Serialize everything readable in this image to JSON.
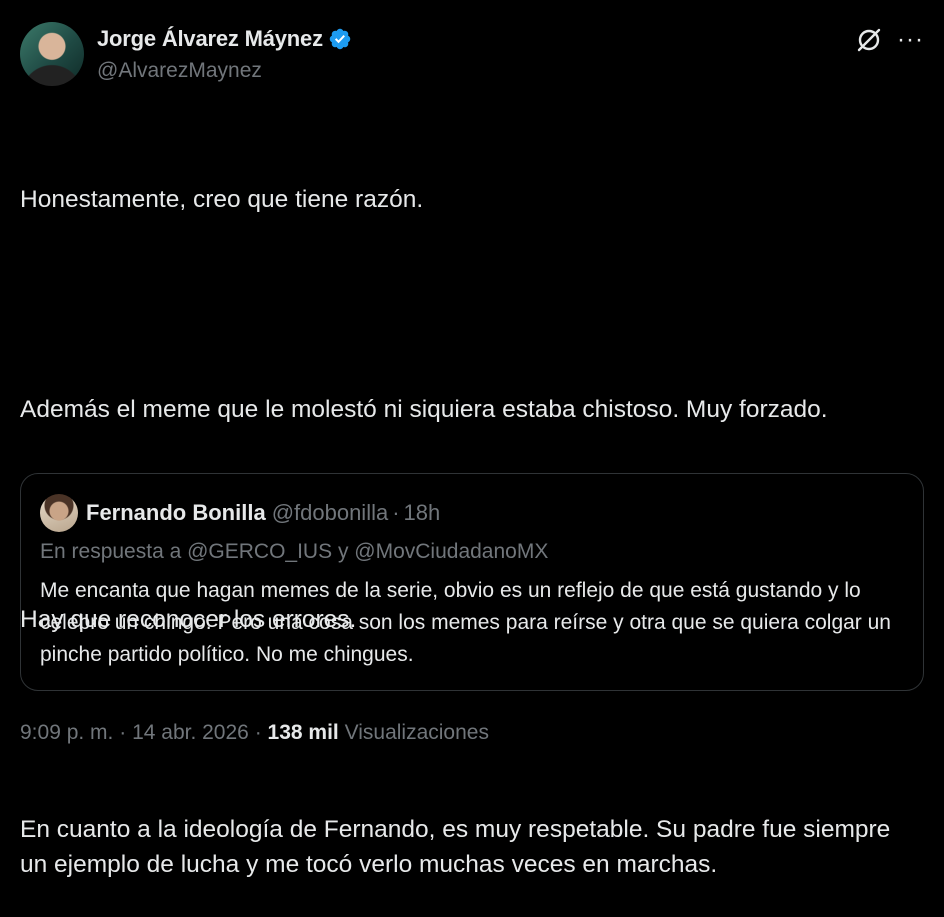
{
  "author": {
    "display_name": "Jorge Álvarez Máynez",
    "handle": "@AlvarezMaynez",
    "verified_icon": "verified-badge-icon"
  },
  "actions": {
    "grok_icon": "grok-icon",
    "more_label": "···"
  },
  "tweet": {
    "paragraphs": [
      "Honestamente, creo que tiene razón.",
      "Además el meme que le molestó ni siquiera estaba chistoso. Muy forzado.",
      "Hay que reconocer los errores.",
      "En cuanto a la ideología de Fernando, es muy respetable. Su padre fue siempre un ejemplo de lucha y me tocó verlo muchas veces en marchas."
    ]
  },
  "quote": {
    "display_name": "Fernando Bonilla",
    "handle": "@fdobonilla",
    "separator": "·",
    "time": "18h",
    "reply_context": "En respuesta a @GERCO_IUS y @MovCiudadanoMX",
    "text": "Me encanta que hagan memes de la serie, obvio es un reflejo de que está gustando y lo celebro un chingo. Pero una cosa son los memes para reírse y otra que se quiera colgar un pinche partido político. No me chingues."
  },
  "meta": {
    "time": "9:09 p. m.",
    "separator": "·",
    "date": "14 abr. 2026",
    "views_count": "138 mil",
    "views_label": "Visualizaciones"
  },
  "colors": {
    "background": "#000000",
    "text": "#e7e9ea",
    "muted": "#71767b",
    "verified": "#1d9bf0",
    "border": "#2f3336"
  }
}
